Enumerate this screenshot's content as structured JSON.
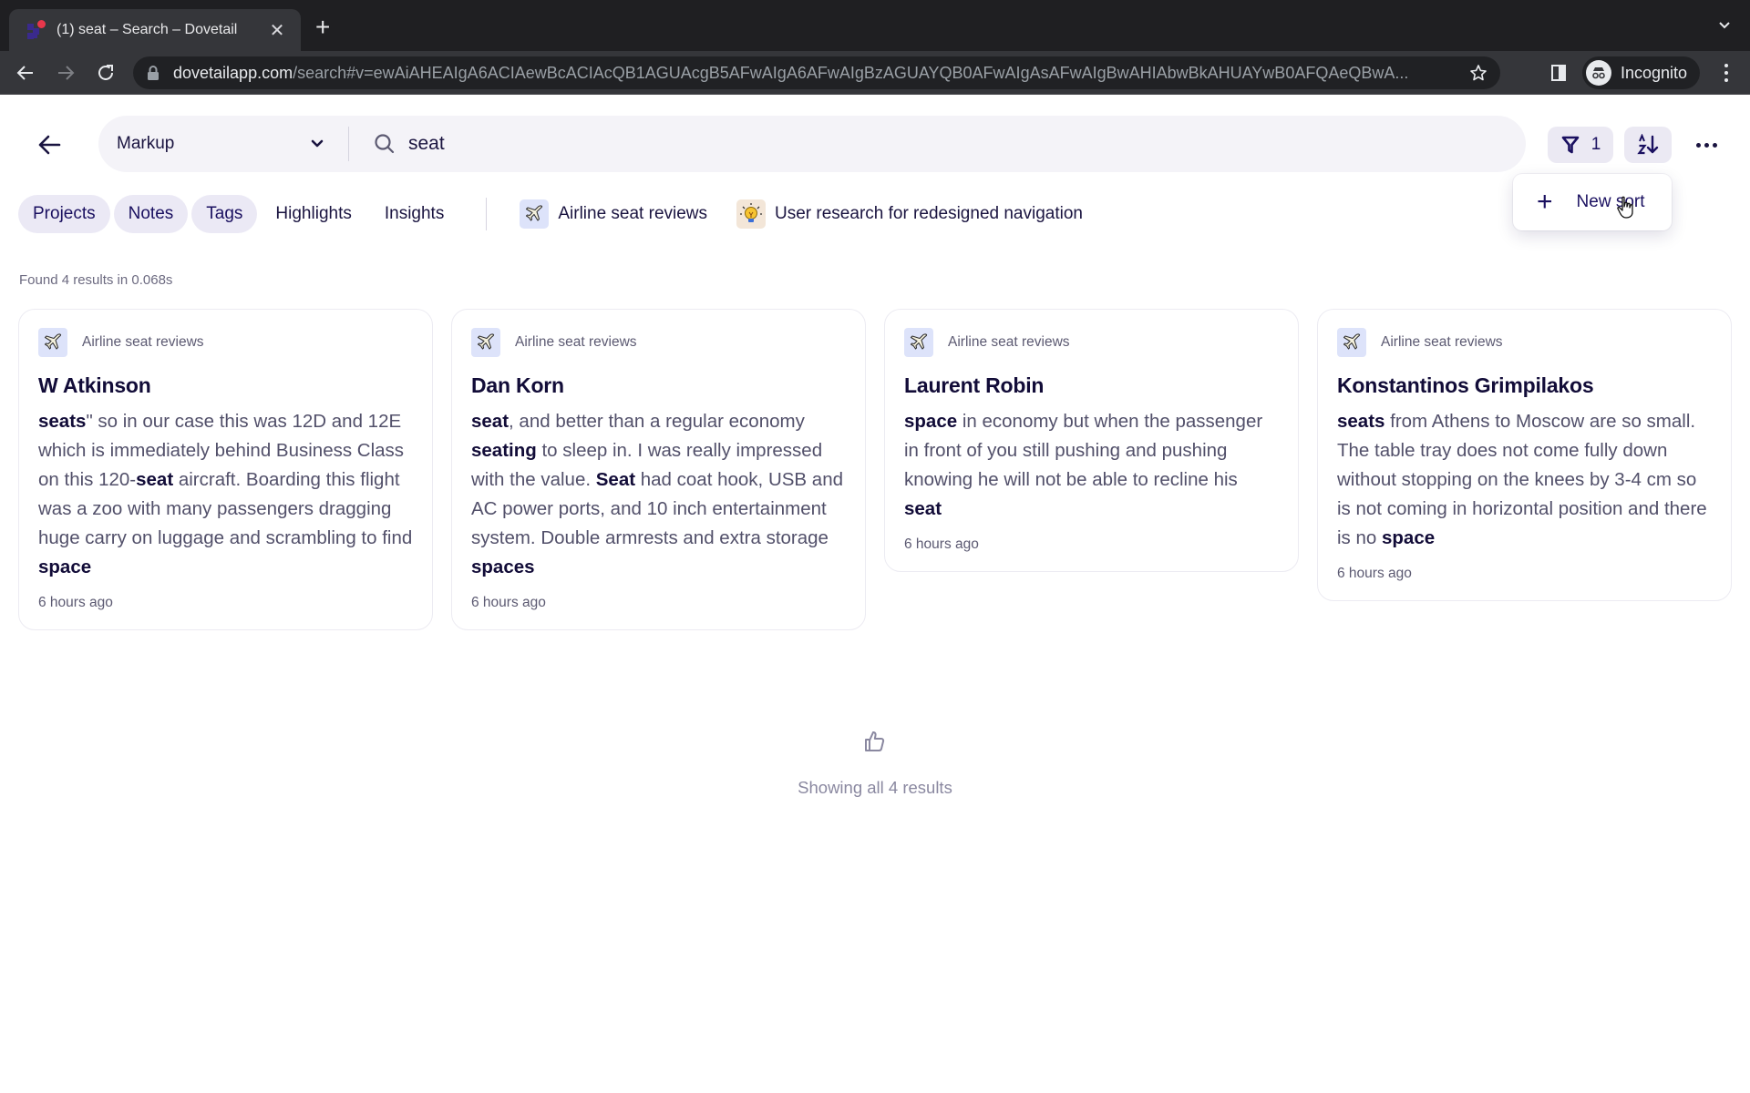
{
  "browser": {
    "tab_title": "(1) seat – Search – Dovetail",
    "url_host": "dovetailapp.com",
    "url_path": "/search#v=ewAiAHEAIgA6ACIAewBcACIAcQB1AGUAcgB5AFwAIgA6AFwAIgBzAGUAYQB0AFwAIgAsAFwAIgBwAHIAbwBkAHUAYwB0AFQAeQBwA...",
    "profile_label": "Incognito"
  },
  "search": {
    "scope": "Markup",
    "query": "seat",
    "filter_count": "1"
  },
  "sort_menu": {
    "new_sort_label": "New sort"
  },
  "filters": {
    "types": [
      {
        "label": "Projects",
        "active": true
      },
      {
        "label": "Notes",
        "active": true
      },
      {
        "label": "Tags",
        "active": true
      },
      {
        "label": "Highlights",
        "active": false
      },
      {
        "label": "Insights",
        "active": false
      }
    ],
    "projects": [
      {
        "label": "Airline seat reviews",
        "icon": "airplane-icon"
      },
      {
        "label": "User research for redesigned navigation",
        "icon": "lightbulb-icon"
      }
    ]
  },
  "results": {
    "summary": "Found 4 results in 0.068s",
    "end_label": "Showing all 4 results",
    "items": [
      {
        "project": "Airline seat reviews",
        "title": "W Atkinson",
        "segments": [
          {
            "t": "seats",
            "b": true
          },
          {
            "t": "\" so in our case this was 12D and 12E which is immediately behind Business Class on this 120-",
            "b": false
          },
          {
            "t": "seat",
            "b": true
          },
          {
            "t": " aircraft. Boarding this flight was a zoo with many passengers dragging huge carry on luggage and scrambling to find ",
            "b": false
          },
          {
            "t": "space",
            "b": true
          }
        ],
        "time": "6 hours ago"
      },
      {
        "project": "Airline seat reviews",
        "title": "Dan Korn",
        "segments": [
          {
            "t": "seat",
            "b": true
          },
          {
            "t": ", and better than a regular economy ",
            "b": false
          },
          {
            "t": "seating",
            "b": true
          },
          {
            "t": " to sleep in. I was really impressed with the value. ",
            "b": false
          },
          {
            "t": "Seat",
            "b": true
          },
          {
            "t": " had coat hook, USB and AC power ports, and 10 inch entertainment system. Double armrests and extra storage ",
            "b": false
          },
          {
            "t": "spaces",
            "b": true
          }
        ],
        "time": "6 hours ago"
      },
      {
        "project": "Airline seat reviews",
        "title": "Laurent Robin",
        "segments": [
          {
            "t": "space",
            "b": true
          },
          {
            "t": " in economy but when the passenger in front of you still pushing and pushing knowing he will not be able to recline his ",
            "b": false
          },
          {
            "t": "seat",
            "b": true
          }
        ],
        "time": "6 hours ago"
      },
      {
        "project": "Airline seat reviews",
        "title": "Konstantinos Grimpilakos",
        "segments": [
          {
            "t": "seats",
            "b": true
          },
          {
            "t": " from Athens to Moscow are so small. The table tray does not come fully down without stopping on the knees by 3-4 cm so is not coming in horizontal position and there is no ",
            "b": false
          },
          {
            "t": "space",
            "b": true
          }
        ],
        "time": "6 hours ago"
      }
    ]
  },
  "colors": {
    "brand_ink": "#1a1060",
    "chip_bg": "#ebe9f5",
    "search_bg": "#f4f3f8"
  }
}
